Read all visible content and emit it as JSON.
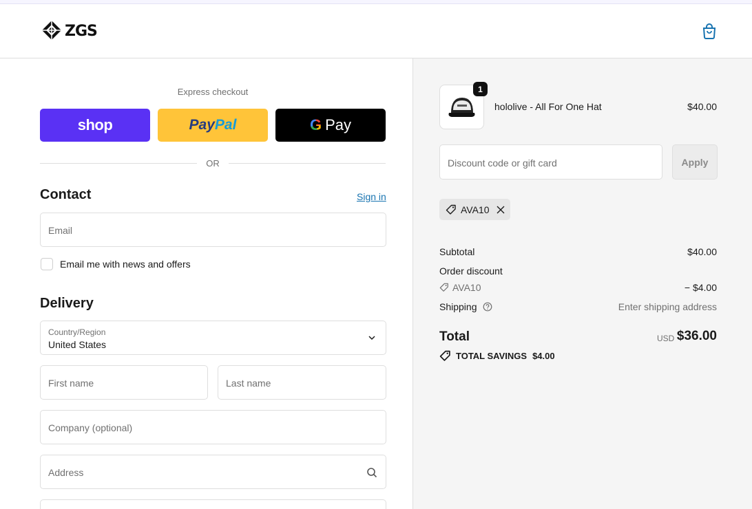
{
  "brand": {
    "logo_text": "ZGS"
  },
  "express": {
    "label": "Express checkout",
    "shop_label": "shop",
    "paypal_part1": "Pay",
    "paypal_part2": "Pal",
    "gpay_g": "G",
    "gpay_label": "Pay",
    "divider": "OR"
  },
  "contact": {
    "title": "Contact",
    "sign_in": "Sign in",
    "email_placeholder": "Email",
    "news_label": "Email me with news and offers"
  },
  "delivery": {
    "title": "Delivery",
    "country_label": "Country/Region",
    "country_value": "United States",
    "first_name_placeholder": "First name",
    "last_name_placeholder": "Last name",
    "company_placeholder": "Company (optional)",
    "address_placeholder": "Address"
  },
  "cart": {
    "item": {
      "name": "hololive - All For One Hat",
      "price": "$40.00",
      "quantity": "1"
    },
    "discount_placeholder": "Discount code or gift card",
    "apply_label": "Apply",
    "applied_code": "AVA10"
  },
  "summary": {
    "subtotal_label": "Subtotal",
    "subtotal_value": "$40.00",
    "order_discount_label": "Order discount",
    "discount_code": "AVA10",
    "discount_value": "− $4.00",
    "shipping_label": "Shipping",
    "shipping_value": "Enter shipping address",
    "total_label": "Total",
    "currency": "USD",
    "total_value": "$36.00",
    "savings_label": "TOTAL SAVINGS",
    "savings_value": "$4.00"
  },
  "colors": {
    "shop_purple": "#5a31f4",
    "paypal_yellow": "#ffc439",
    "link_blue": "#1773b0"
  }
}
